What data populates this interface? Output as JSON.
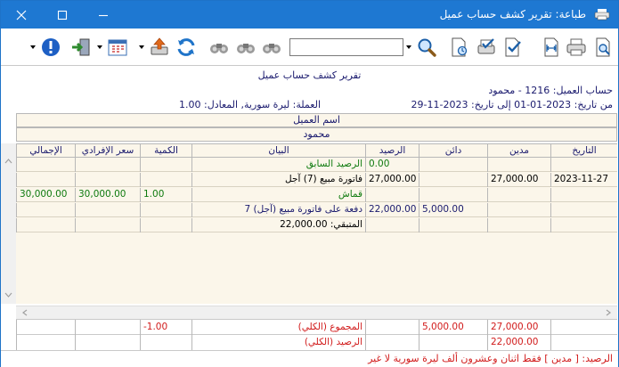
{
  "window": {
    "title": "طباعة: تقرير كشف حساب عميل"
  },
  "toolbar": {
    "search_value": ""
  },
  "report": {
    "title": "تقرير كشف حساب عميل",
    "account_line": "حساب العميل: 1216 - محمود",
    "date_line": "من تاريخ: 2023-01-01  إلى تاريخ: 2023-11-29",
    "currency_line": "العملة: ليرة سورية, المعادل: 1.00",
    "group_label": "اسم العميل",
    "group_value": "محمود"
  },
  "columns": {
    "date": "التاريخ",
    "debit": "مدين",
    "credit": "دائن",
    "balance": "الرصيد",
    "description": "البيان",
    "quantity": "الكمية",
    "unit_price": "سعر الإفرادي",
    "total": "الإجمالي"
  },
  "rows": [
    {
      "date": "",
      "debit": "",
      "credit": "",
      "balance": "0.00",
      "description": "الرصيد السابق",
      "quantity": "",
      "unit_price": "",
      "total": ""
    },
    {
      "date": "2023-11-27",
      "debit": "27,000.00",
      "credit": "",
      "balance": "27,000.00",
      "description": "فاتورة مبيع (7) آجل",
      "quantity": "",
      "unit_price": "",
      "total": ""
    },
    {
      "date": "",
      "debit": "",
      "credit": "",
      "balance": "",
      "description": "قماش",
      "quantity": "1.00",
      "unit_price": "30,000.00",
      "total": "30,000.00"
    },
    {
      "date": "",
      "debit": "",
      "credit": "5,000.00",
      "balance": "22,000.00",
      "description": "دفعة على فاتورة مبيع (آجل) 7",
      "quantity": "",
      "unit_price": "",
      "total": ""
    },
    {
      "date": "",
      "debit": "",
      "credit": "",
      "balance": "",
      "description": "المتبقي: 22,000.00",
      "quantity": "",
      "unit_price": "",
      "total": ""
    }
  ],
  "footer": {
    "total_label": "المجموع (الكلي)",
    "total_debit": "27,000.00",
    "total_credit": "5,000.00",
    "total_qty": "-1.00",
    "balance_label": "الرصيد (الكلي)",
    "balance_debit": "22,000.00",
    "balance_words": "الرصيد: [ مدين ] فقط اثنان وعشرون ألف ليرة سورية لا غير"
  },
  "colors": {
    "titlebar": "#1e78d2",
    "grid_bg": "#fbf6ea",
    "navy_text": "#1a1a6e",
    "green_text": "#0e7a0e",
    "red_text": "#d11b1b"
  },
  "icons": [
    "print-preview-icon",
    "print-icon",
    "fit-width-icon",
    "check-doc-icon",
    "check-print-icon",
    "doc-settings-icon",
    "search-icon",
    "binoculars-icon",
    "refresh-icon",
    "export-icon",
    "calendar-icon",
    "exit-icon",
    "info-icon"
  ]
}
